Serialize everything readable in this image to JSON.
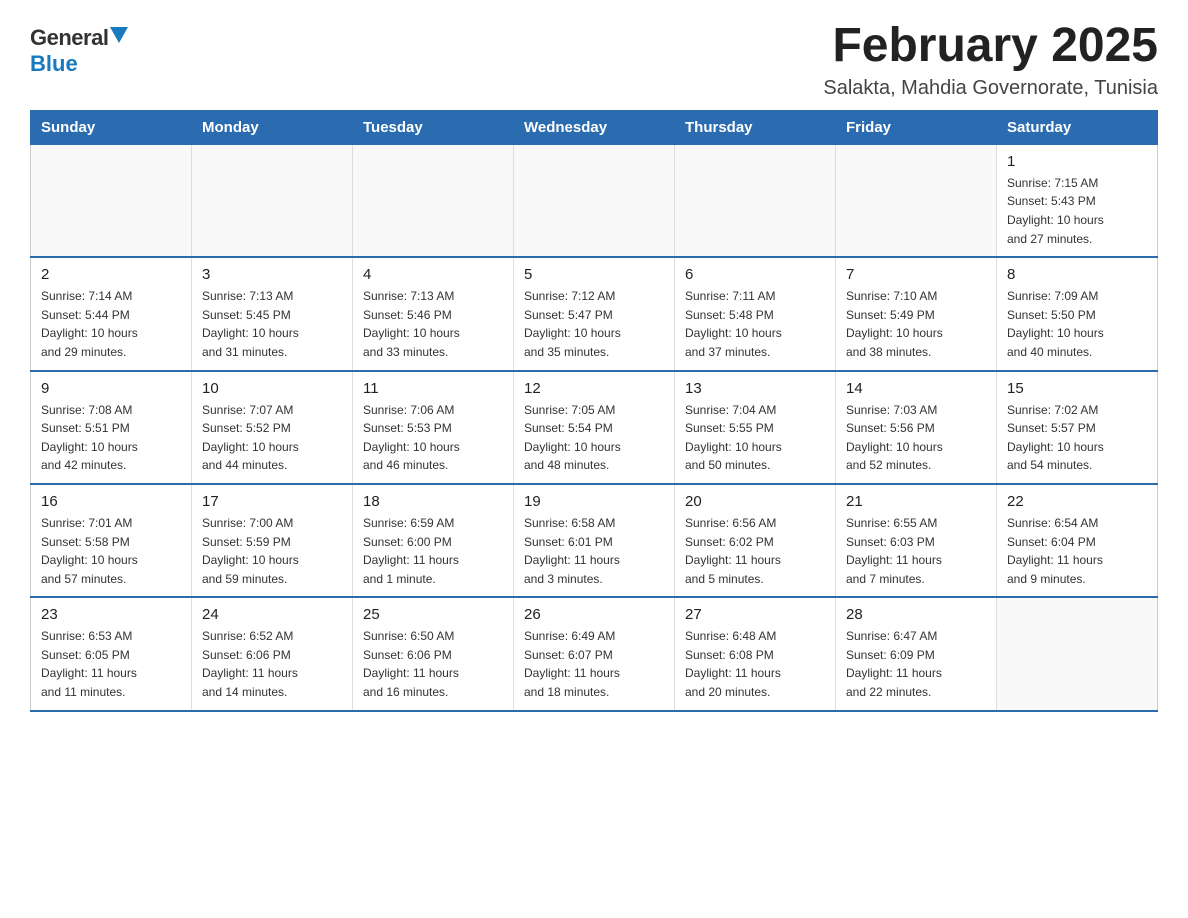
{
  "header": {
    "logo_general": "General",
    "logo_blue": "Blue",
    "title": "February 2025",
    "subtitle": "Salakta, Mahdia Governorate, Tunisia"
  },
  "calendar": {
    "days_of_week": [
      "Sunday",
      "Monday",
      "Tuesday",
      "Wednesday",
      "Thursday",
      "Friday",
      "Saturday"
    ],
    "weeks": [
      [
        {
          "day": "",
          "info": ""
        },
        {
          "day": "",
          "info": ""
        },
        {
          "day": "",
          "info": ""
        },
        {
          "day": "",
          "info": ""
        },
        {
          "day": "",
          "info": ""
        },
        {
          "day": "",
          "info": ""
        },
        {
          "day": "1",
          "info": "Sunrise: 7:15 AM\nSunset: 5:43 PM\nDaylight: 10 hours\nand 27 minutes."
        }
      ],
      [
        {
          "day": "2",
          "info": "Sunrise: 7:14 AM\nSunset: 5:44 PM\nDaylight: 10 hours\nand 29 minutes."
        },
        {
          "day": "3",
          "info": "Sunrise: 7:13 AM\nSunset: 5:45 PM\nDaylight: 10 hours\nand 31 minutes."
        },
        {
          "day": "4",
          "info": "Sunrise: 7:13 AM\nSunset: 5:46 PM\nDaylight: 10 hours\nand 33 minutes."
        },
        {
          "day": "5",
          "info": "Sunrise: 7:12 AM\nSunset: 5:47 PM\nDaylight: 10 hours\nand 35 minutes."
        },
        {
          "day": "6",
          "info": "Sunrise: 7:11 AM\nSunset: 5:48 PM\nDaylight: 10 hours\nand 37 minutes."
        },
        {
          "day": "7",
          "info": "Sunrise: 7:10 AM\nSunset: 5:49 PM\nDaylight: 10 hours\nand 38 minutes."
        },
        {
          "day": "8",
          "info": "Sunrise: 7:09 AM\nSunset: 5:50 PM\nDaylight: 10 hours\nand 40 minutes."
        }
      ],
      [
        {
          "day": "9",
          "info": "Sunrise: 7:08 AM\nSunset: 5:51 PM\nDaylight: 10 hours\nand 42 minutes."
        },
        {
          "day": "10",
          "info": "Sunrise: 7:07 AM\nSunset: 5:52 PM\nDaylight: 10 hours\nand 44 minutes."
        },
        {
          "day": "11",
          "info": "Sunrise: 7:06 AM\nSunset: 5:53 PM\nDaylight: 10 hours\nand 46 minutes."
        },
        {
          "day": "12",
          "info": "Sunrise: 7:05 AM\nSunset: 5:54 PM\nDaylight: 10 hours\nand 48 minutes."
        },
        {
          "day": "13",
          "info": "Sunrise: 7:04 AM\nSunset: 5:55 PM\nDaylight: 10 hours\nand 50 minutes."
        },
        {
          "day": "14",
          "info": "Sunrise: 7:03 AM\nSunset: 5:56 PM\nDaylight: 10 hours\nand 52 minutes."
        },
        {
          "day": "15",
          "info": "Sunrise: 7:02 AM\nSunset: 5:57 PM\nDaylight: 10 hours\nand 54 minutes."
        }
      ],
      [
        {
          "day": "16",
          "info": "Sunrise: 7:01 AM\nSunset: 5:58 PM\nDaylight: 10 hours\nand 57 minutes."
        },
        {
          "day": "17",
          "info": "Sunrise: 7:00 AM\nSunset: 5:59 PM\nDaylight: 10 hours\nand 59 minutes."
        },
        {
          "day": "18",
          "info": "Sunrise: 6:59 AM\nSunset: 6:00 PM\nDaylight: 11 hours\nand 1 minute."
        },
        {
          "day": "19",
          "info": "Sunrise: 6:58 AM\nSunset: 6:01 PM\nDaylight: 11 hours\nand 3 minutes."
        },
        {
          "day": "20",
          "info": "Sunrise: 6:56 AM\nSunset: 6:02 PM\nDaylight: 11 hours\nand 5 minutes."
        },
        {
          "day": "21",
          "info": "Sunrise: 6:55 AM\nSunset: 6:03 PM\nDaylight: 11 hours\nand 7 minutes."
        },
        {
          "day": "22",
          "info": "Sunrise: 6:54 AM\nSunset: 6:04 PM\nDaylight: 11 hours\nand 9 minutes."
        }
      ],
      [
        {
          "day": "23",
          "info": "Sunrise: 6:53 AM\nSunset: 6:05 PM\nDaylight: 11 hours\nand 11 minutes."
        },
        {
          "day": "24",
          "info": "Sunrise: 6:52 AM\nSunset: 6:06 PM\nDaylight: 11 hours\nand 14 minutes."
        },
        {
          "day": "25",
          "info": "Sunrise: 6:50 AM\nSunset: 6:06 PM\nDaylight: 11 hours\nand 16 minutes."
        },
        {
          "day": "26",
          "info": "Sunrise: 6:49 AM\nSunset: 6:07 PM\nDaylight: 11 hours\nand 18 minutes."
        },
        {
          "day": "27",
          "info": "Sunrise: 6:48 AM\nSunset: 6:08 PM\nDaylight: 11 hours\nand 20 minutes."
        },
        {
          "day": "28",
          "info": "Sunrise: 6:47 AM\nSunset: 6:09 PM\nDaylight: 11 hours\nand 22 minutes."
        },
        {
          "day": "",
          "info": ""
        }
      ]
    ]
  }
}
